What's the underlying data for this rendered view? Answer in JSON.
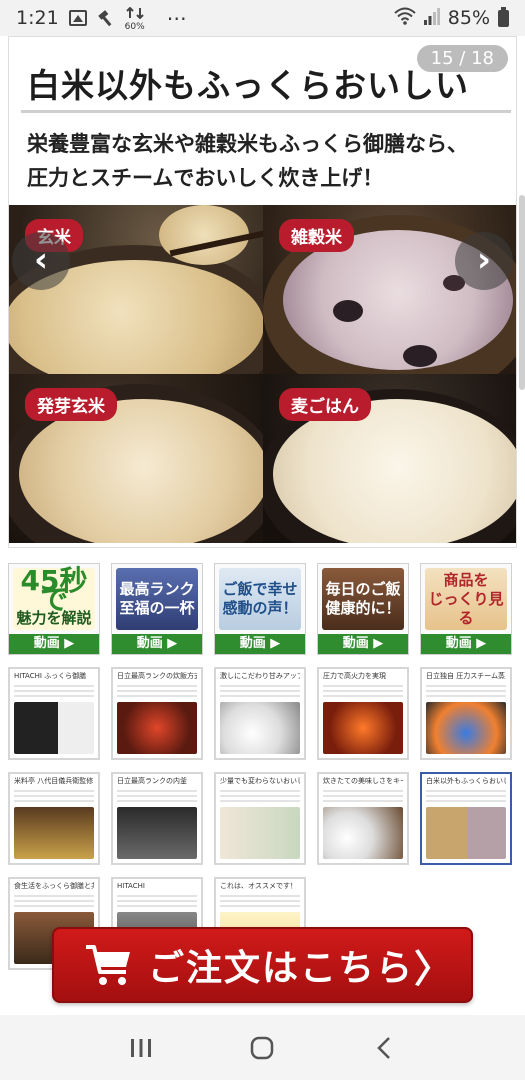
{
  "status_bar": {
    "time": "1:21",
    "data_indicator": "60%",
    "overflow": "⋯",
    "battery": "85%"
  },
  "article": {
    "title": "白米以外もふっくらおいしい",
    "counter": "15 / 18",
    "subtitle_lines": [
      "栄養豊富な玄米や雑穀米もふっくら御膳なら、",
      "圧力とスチームでおいしく炊き上げ！"
    ],
    "photos": [
      {
        "label": "玄米"
      },
      {
        "label": "雑穀米"
      },
      {
        "label": "発芽玄米"
      },
      {
        "label": "麦ごはん"
      }
    ],
    "prev_glyph": "‹",
    "next_glyph": "›"
  },
  "video_thumbs": [
    {
      "line1": "45秒で",
      "line2": "魅力を解説",
      "bar": "動画 ▶"
    },
    {
      "line1": "最高ランク",
      "line2": "至福の一杯",
      "bar": "動画 ▶"
    },
    {
      "line1": "ご飯で幸せ",
      "line2": "感動の声！",
      "bar": "動画 ▶"
    },
    {
      "line1": "毎日のご飯",
      "line2": "健康的に！",
      "bar": "動画 ▶"
    },
    {
      "line1": "商品を",
      "line2": "じっくり見る",
      "bar": "動画 ▶"
    }
  ],
  "slide_thumbs": [
    {
      "head": "HITACHI ふっくら御膳"
    },
    {
      "head": "日立最高ランクの炊飯方式"
    },
    {
      "head": "激しにこだわり甘みアップ"
    },
    {
      "head": "圧力で高火力を実現"
    },
    {
      "head": "日立独自 圧力スチーム蒸らし"
    },
    {
      "head": "米料亭 八代目儀兵衛監修"
    },
    {
      "head": "日立最高ランクの内釜"
    },
    {
      "head": "少量でも変わらないおいしさ"
    },
    {
      "head": "炊きたての美味しさをキープ"
    },
    {
      "head": "白米以外もふっくらおいしい"
    },
    {
      "head": "食生活をふっくら御膳と共に"
    },
    {
      "head": "HITACHI"
    },
    {
      "head": "これは、オススメです！"
    }
  ],
  "order_button": {
    "label": "ご注文はこちら",
    "chevron": "〉"
  },
  "colors": {
    "accent_red": "#b91c2c",
    "video_green": "#2f8c2f",
    "order_red": "#c41414",
    "active_border": "#3a5da8"
  }
}
